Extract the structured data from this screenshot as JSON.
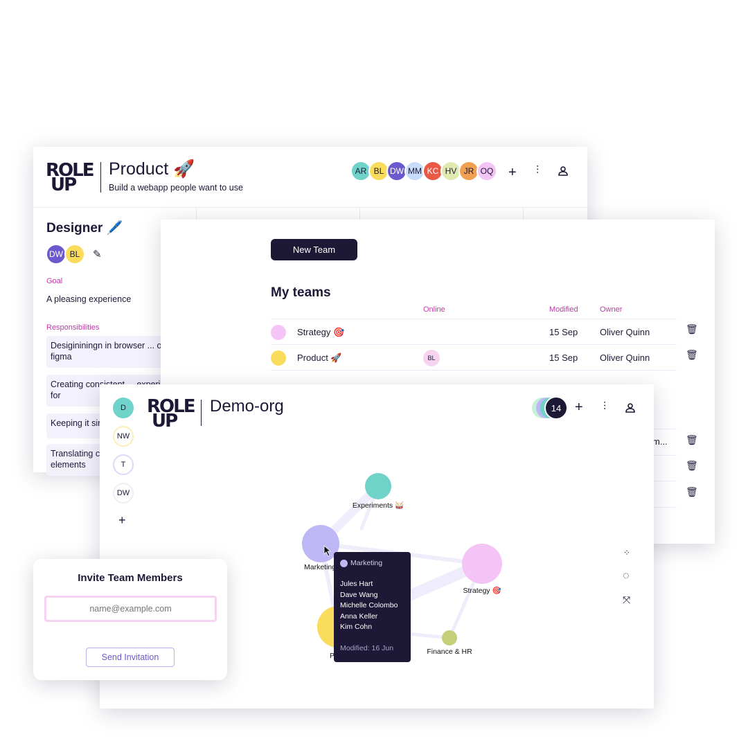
{
  "product_window": {
    "logo": "ROLE UP",
    "title": "Product",
    "title_emoji": "🚀",
    "subtitle": "Build a webapp people want to use",
    "members": [
      {
        "initials": "AR",
        "color": "#6fd3c9"
      },
      {
        "initials": "BL",
        "color": "#f9dc5c"
      },
      {
        "initials": "DW",
        "color": "#6a5acd"
      },
      {
        "initials": "MM",
        "color": "#c7dbfa"
      },
      {
        "initials": "KC",
        "color": "#e85a45"
      },
      {
        "initials": "HV",
        "color": "#dfeab0"
      },
      {
        "initials": "JR",
        "color": "#f0a050"
      },
      {
        "initials": "OQ",
        "color": "#f3c4f5"
      }
    ],
    "add_label": "+",
    "role": {
      "title": "Designer",
      "emoji": "🖊️",
      "members": [
        {
          "initials": "DW",
          "color": "#6a5acd"
        },
        {
          "initials": "BL",
          "color": "#f9dc5c"
        }
      ],
      "goal_label": "Goal",
      "goal": "A pleasing experience",
      "responsibilities_label": "Responsibilities",
      "responsibilities": [
        "Desigininingn in browser ... or figma",
        "Creating consistent ... experience for",
        "Keeping it simple",
        "Translating complex ... simple elements"
      ]
    }
  },
  "teams_window": {
    "new_team_label": "New Team",
    "heading": "My teams",
    "columns": {
      "online": "Online",
      "modified": "Modified",
      "owner": "Owner"
    },
    "rows": [
      {
        "color": "#f3c4f5",
        "name": "Strategy 🎯",
        "online": "",
        "modified": "15 Sep",
        "owner": "Oliver Quinn"
      },
      {
        "color": "#f9dc5c",
        "name": "Product 🚀",
        "online": "BL",
        "modified": "15 Sep",
        "owner": "Oliver Quinn"
      }
    ],
    "partial_row_text": "m..."
  },
  "org_window": {
    "logo": "ROLE UP",
    "title": "Demo-org",
    "member_count": "14",
    "add_label": "+",
    "sidebar": [
      {
        "label": "D",
        "color": "#6fd3c9",
        "border": "#6fd3c9"
      },
      {
        "label": "NW",
        "color": "#fff",
        "border": "#fbeeb8"
      },
      {
        "label": "T",
        "color": "#fff",
        "border": "#ddd9f7"
      },
      {
        "label": "DW",
        "color": "#fff",
        "border": "#eeeef5"
      }
    ],
    "sidebar_add": "+",
    "graph": {
      "nodes": [
        {
          "name": "Experiments 🥁",
          "color": "#6fd3c9"
        },
        {
          "name": "Marketing",
          "color": "#bdb8f5"
        },
        {
          "name": "Strategy 🎯",
          "color": "#f3c4f5"
        },
        {
          "name": "Product 🚀",
          "color": "#f9dc5c"
        },
        {
          "name": "Finance & HR",
          "color": "#c4cf7a"
        }
      ],
      "tooltip": {
        "team": "Marketing",
        "members": [
          "Jules Hart",
          "Dave Wang",
          "Michelle Colombo",
          "Anna Keller",
          "Kim Cohn"
        ],
        "modified": "Modified: 16 Jun"
      }
    },
    "tools": [
      "cluster-layout-icon",
      "circle-layout-icon",
      "collapse-icon"
    ]
  },
  "invite": {
    "title": "Invite Team Members",
    "placeholder": "name@example.com",
    "button": "Send Invitation"
  }
}
